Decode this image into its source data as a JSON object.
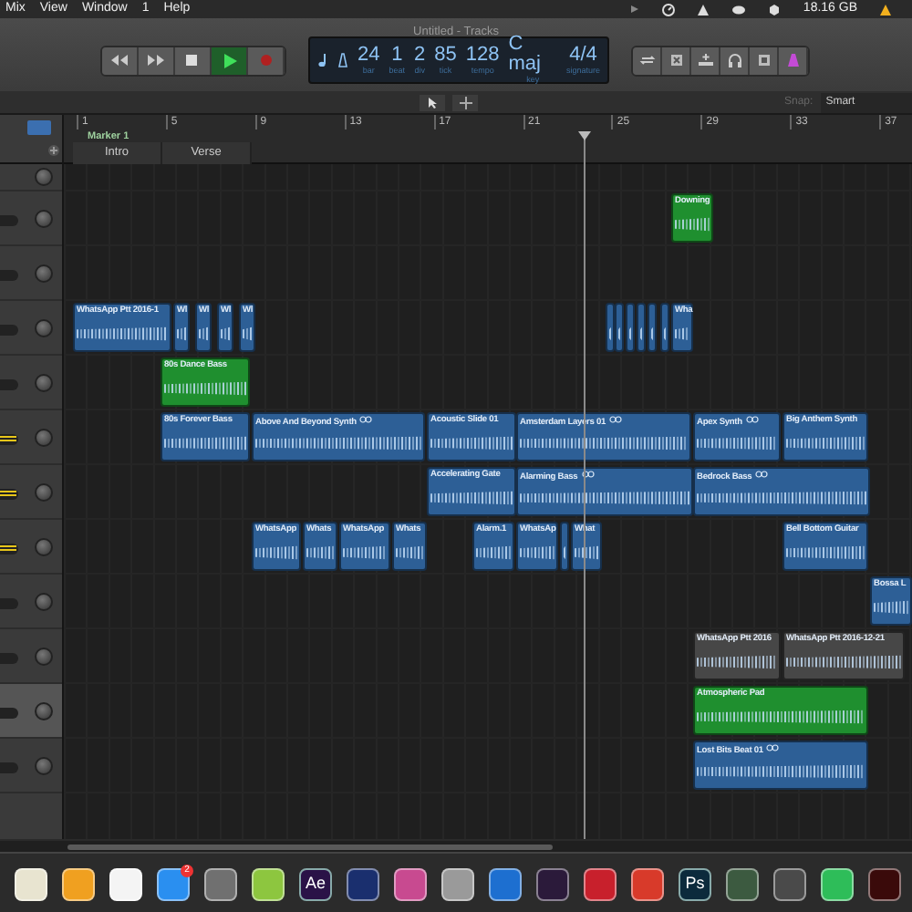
{
  "menu_bar": {
    "items": [
      "Mix",
      "View",
      "Window",
      "1",
      "Help"
    ],
    "disk_space": "18.16 GB"
  },
  "window": {
    "title": "Untitled - Tracks"
  },
  "transport": {
    "playing": true,
    "recording": false
  },
  "lcd": [
    {
      "value": "24",
      "label": "bar"
    },
    {
      "value": "1",
      "label": "beat"
    },
    {
      "value": "2",
      "label": "div"
    },
    {
      "value": "85",
      "label": "tick"
    },
    {
      "value": "128",
      "label": "tempo"
    },
    {
      "value": "C maj",
      "label": "key"
    },
    {
      "value": "4/4",
      "label": "signature"
    }
  ],
  "snap": {
    "label": "Snap:",
    "value": "Smart"
  },
  "ruler": [
    "1",
    "5",
    "9",
    "13",
    "17",
    "21",
    "25",
    "29",
    "33",
    "37"
  ],
  "marker": "Marker 1",
  "arrangement": [
    "Intro",
    "Verse"
  ],
  "tracks": [
    {
      "selected": false
    },
    {
      "selected": false,
      "metering": false,
      "regions": [
        {
          "name": "Downing",
          "color": "#1f8f2f",
          "looped": false
        }
      ]
    },
    {
      "selected": false,
      "metering": false
    },
    {
      "selected": false,
      "metering": false,
      "regions": [
        {
          "name": "WhatsApp Ptt 2016-1",
          "color": "#2d5f96",
          "looped": false
        },
        {
          "name": "Wl",
          "color": "#2d5f96",
          "looped": false
        },
        {
          "name": "Wl",
          "color": "#2d5f96",
          "looped": false
        },
        {
          "name": "Wl",
          "color": "#2d5f96",
          "looped": false
        },
        {
          "name": "Wl",
          "color": "#2d5f96",
          "looped": false
        },
        {
          "color": "#2d5f96",
          "looped": false
        },
        {
          "color": "#2d5f96",
          "looped": false
        },
        {
          "color": "#2d5f96",
          "looped": false
        },
        {
          "color": "#2d5f96",
          "looped": false
        },
        {
          "color": "#2d5f96",
          "looped": false
        },
        {
          "color": "#2d5f96",
          "looped": false
        },
        {
          "name": "Wha",
          "color": "#2d5f96",
          "looped": false
        }
      ]
    },
    {
      "selected": false,
      "metering": false,
      "regions": [
        {
          "name": "80s Dance Bass",
          "color": "#1f8f2f",
          "looped": false
        }
      ]
    },
    {
      "selected": false,
      "metering": true,
      "regions": [
        {
          "name": "80s Forever Bass",
          "color": "#2d5f96",
          "looped": false
        },
        {
          "name": "Above And Beyond Synth",
          "color": "#2d5f96",
          "looped": true
        },
        {
          "name": "Acoustic Slide 01",
          "color": "#2d5f96",
          "looped": false
        },
        {
          "name": "Amsterdam Layers 01",
          "color": "#2d5f96",
          "looped": true
        },
        {
          "name": "Apex Synth",
          "color": "#2d5f96",
          "looped": true
        },
        {
          "name": "Big Anthem Synth",
          "color": "#2d5f96",
          "looped": false
        }
      ]
    },
    {
      "selected": false,
      "metering": true,
      "regions": [
        {
          "name": "Accelerating Gate",
          "color": "#2d5f96",
          "looped": false
        },
        {
          "name": "Alarming Bass",
          "color": "#2d5f96",
          "looped": true
        },
        {
          "name": "Bedrock Bass",
          "color": "#2d5f96",
          "looped": true
        }
      ]
    },
    {
      "selected": false,
      "metering": true,
      "regions": [
        {
          "name": "WhatsApp",
          "color": "#2d5f96",
          "looped": false
        },
        {
          "name": "Whats",
          "color": "#2d5f96",
          "looped": false
        },
        {
          "name": "WhatsApp",
          "color": "#2d5f96",
          "looped": false
        },
        {
          "name": "Whats",
          "color": "#2d5f96",
          "looped": false
        },
        {
          "name": "Alarm.1",
          "color": "#2d5f96",
          "looped": false
        },
        {
          "name": "WhatsAp",
          "color": "#2d5f96",
          "looped": false
        },
        {
          "color": "#2d5f96",
          "looped": false
        },
        {
          "name": "What",
          "color": "#2d5f96",
          "looped": false
        },
        {
          "name": "Bell Bottom Guitar",
          "color": "#2d5f96",
          "looped": false
        }
      ]
    },
    {
      "selected": false,
      "metering": false,
      "regions": [
        {
          "name": "Bossa L",
          "color": "#2d5f96",
          "looped": false
        }
      ]
    },
    {
      "selected": false,
      "metering": false,
      "regions": [
        {
          "name": "WhatsApp Ptt 2016",
          "color": "#474747",
          "looped": false
        },
        {
          "name": "WhatsApp Ptt 2016-12-21",
          "color": "#474747",
          "looped": false
        }
      ]
    },
    {
      "selected": true,
      "metering": false,
      "regions": [
        {
          "name": "Atmospheric Pad",
          "color": "#1f8f2f",
          "looped": false
        }
      ]
    },
    {
      "selected": false,
      "metering": false,
      "regions": [
        {
          "name": "Lost Bits Beat 01",
          "color": "#2d5f96",
          "looped": true
        }
      ]
    }
  ],
  "dock": [
    {
      "color": "#e8e4d0"
    },
    {
      "color": "#f0a020"
    },
    {
      "color": "#f4f4f4"
    },
    {
      "color": "#2a8ff0",
      "badge": "2"
    },
    {
      "color": "#707070"
    },
    {
      "color": "#8dc63f"
    },
    {
      "color": "#2a1247",
      "label": "Ae"
    },
    {
      "color": "#1a2f6e"
    },
    {
      "color": "#c84a90"
    },
    {
      "color": "#9a9a9a"
    },
    {
      "color": "#1d6fd0"
    },
    {
      "color": "#2b1a3a"
    },
    {
      "color": "#c8202c"
    },
    {
      "color": "#d83a2a"
    },
    {
      "color": "#0c2a3c",
      "label": "Ps"
    },
    {
      "color": "#3c5a40"
    },
    {
      "color": "#4a4a4a"
    },
    {
      "color": "#2ebd59"
    },
    {
      "color": "#3a0a0a"
    }
  ]
}
